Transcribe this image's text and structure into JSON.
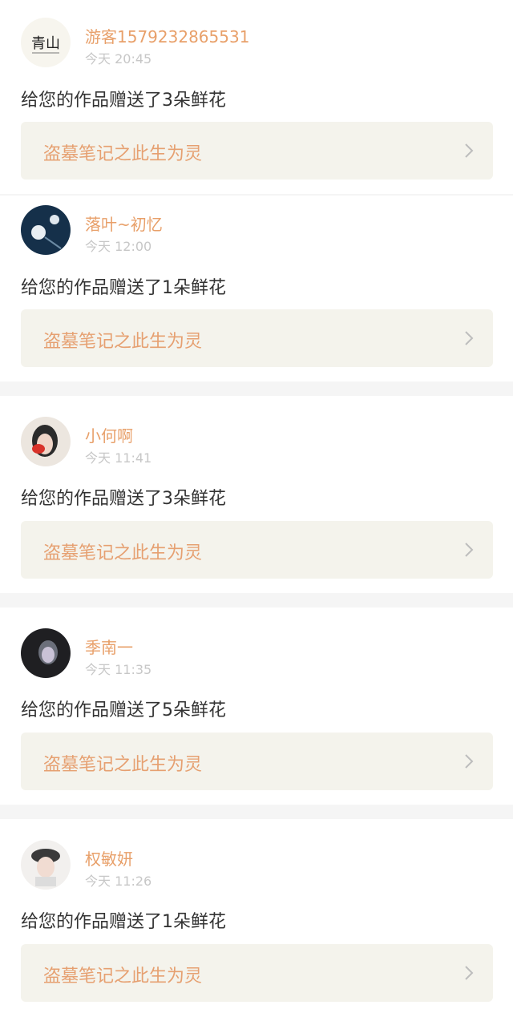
{
  "notifications": [
    {
      "user": "游客1579232865531",
      "time": "今天 20:45",
      "message": "给您的作品赠送了3朵鲜花",
      "work_title": "盗墓笔记之此生为灵",
      "avatar": "calligraphy-avatar"
    },
    {
      "user": "落叶~初忆",
      "time": "今天 12:00",
      "message": "给您的作品赠送了1朵鲜花",
      "work_title": "盗墓笔记之此生为灵",
      "avatar": "flower-avatar"
    },
    {
      "user": "小何啊",
      "time": "今天 11:41",
      "message": "给您的作品赠送了3朵鲜花",
      "work_title": "盗墓笔记之此生为灵",
      "avatar": "girl-avatar"
    },
    {
      "user": "季南一",
      "time": "今天 11:35",
      "message": "给您的作品赠送了5朵鲜花",
      "work_title": "盗墓笔记之此生为灵",
      "avatar": "dark-portrait-avatar"
    },
    {
      "user": "权敏妍",
      "time": "今天 11:26",
      "message": "给您的作品赠送了1朵鲜花",
      "work_title": "盗墓笔记之此生为灵",
      "avatar": "girl-hat-avatar"
    }
  ],
  "colors": {
    "accent": "#e8a06a",
    "card_bg": "#f4f3ec",
    "separator": "#f5f5f5"
  },
  "icons": {
    "chevron": "chevron-right-icon"
  }
}
